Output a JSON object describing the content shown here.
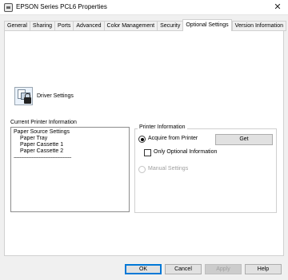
{
  "window": {
    "title": "EPSON  Series PCL6 Properties",
    "close_glyph": "✕"
  },
  "tabs": [
    {
      "label": "General"
    },
    {
      "label": "Sharing"
    },
    {
      "label": "Ports"
    },
    {
      "label": "Advanced"
    },
    {
      "label": "Color Management"
    },
    {
      "label": "Security"
    },
    {
      "label": "Optional Settings",
      "active": true
    },
    {
      "label": "Version Information"
    }
  ],
  "driver_settings": {
    "label": "Driver Settings",
    "icon": "printer-lock-icon"
  },
  "current_printer_info": {
    "label": "Current Printer Information",
    "lines": [
      "Paper Source Settings",
      "Paper Tray",
      "Paper Cassette 1",
      "Paper Cassette 2",
      "------------------------------------------------"
    ]
  },
  "printer_information": {
    "label": "Printer Information",
    "acquire_label": "Acquire from Printer",
    "acquire_selected": true,
    "get_button": "Get",
    "only_optional_label": "Only Optional Information",
    "only_optional_checked": false,
    "manual_label": "Manual Settings",
    "manual_selected": false
  },
  "buttons": {
    "ok": "OK",
    "cancel": "Cancel",
    "apply": "Apply",
    "help": "Help"
  }
}
